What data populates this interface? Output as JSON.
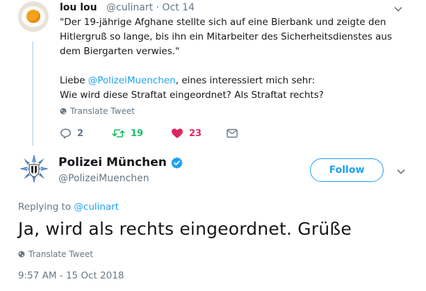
{
  "reply_tweet": {
    "display_name": "lou lou",
    "handle": "@culinart",
    "separator": "·",
    "date": "Oct 14",
    "text_lines": [
      "\"Der 19-jährige Afghane stellte sich auf eine Bierbank und zeigte den",
      "Hitlergruß so lange, bis ihn ein Mitarbeiter des Sicherheitsdienstes aus",
      "dem Biergarten verwies.\""
    ],
    "line_liebe": "Liebe ",
    "mention": "@PolizeiMuenchen",
    "line_liebe_rest": ", eines interessiert mich sehr:",
    "line_question": "Wie wird diese Straftat eingeordnet? Als Straftat rechts?",
    "translate_label": "Translate Tweet",
    "reply_count": "2",
    "retweet_count": "19",
    "like_count": "23",
    "colors": {
      "retweeted": "#17bf63",
      "liked": "#e0245e"
    }
  },
  "main_tweet": {
    "display_name": "Polizei München",
    "handle": "@PolizeiMuenchen",
    "follow_label": "Follow",
    "replying_prefix": "Replying to ",
    "replying_handle": "@culinart",
    "text": "Ja, wird als rechts eingeordnet. Grüße",
    "translate_label": "Translate Tweet",
    "timestamp": "9:57 AM - 15 Oct 2018"
  },
  "colors": {
    "accent": "#1da1f2",
    "muted": "#657786",
    "thread": "#cbe3f5"
  },
  "icons": [
    "egg-avatar",
    "caret-down-icon",
    "globe-icon",
    "reply-icon",
    "retweet-icon",
    "heart-icon",
    "message-icon",
    "police-badge-avatar",
    "verified-badge-icon"
  ]
}
